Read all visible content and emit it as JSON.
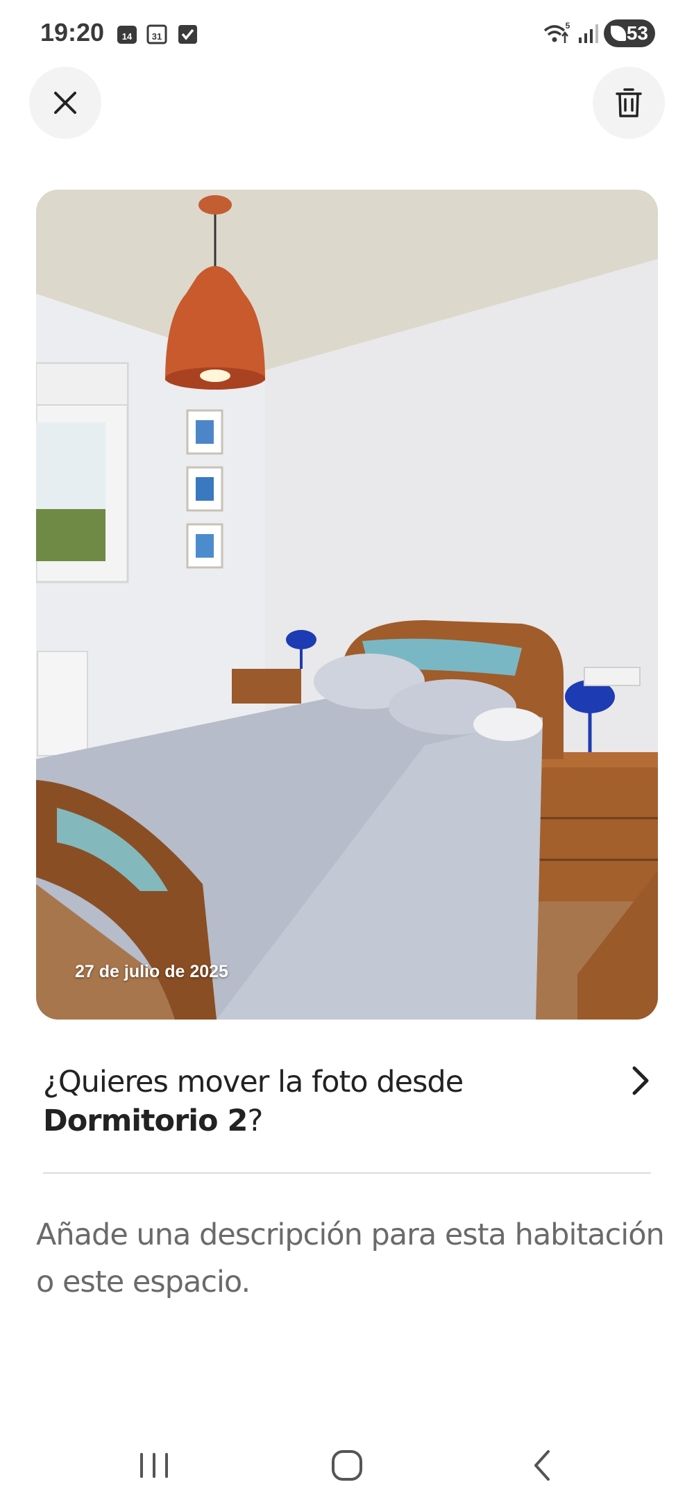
{
  "status_bar": {
    "time": "19:20",
    "calendar_day_a": "14",
    "calendar_day_b": "31",
    "wifi_badge": "5",
    "battery": "53"
  },
  "photo": {
    "date": "27 de julio de 2025"
  },
  "move_prompt": {
    "prefix": "¿Quieres mover la foto desde ",
    "room": "Dormitorio 2",
    "suffix": "?"
  },
  "description": {
    "placeholder": "Añade una descripción para esta habitación o este espacio."
  },
  "icons": {
    "close": "close-icon",
    "trash": "trash-icon",
    "chevron": "chevron-right-icon"
  }
}
